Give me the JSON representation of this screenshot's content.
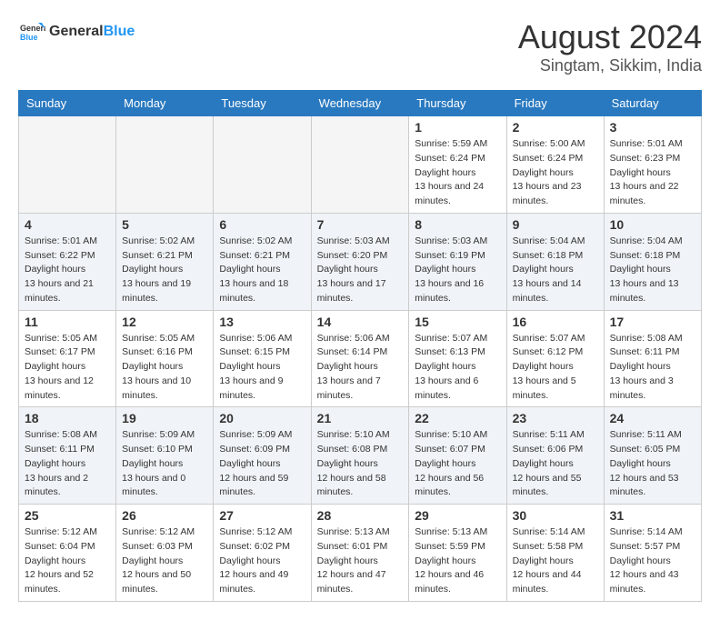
{
  "header": {
    "logo": {
      "general": "General",
      "blue": "Blue"
    },
    "title": "August 2024",
    "location": "Singtam, Sikkim, India"
  },
  "calendar": {
    "days_of_week": [
      "Sunday",
      "Monday",
      "Tuesday",
      "Wednesday",
      "Thursday",
      "Friday",
      "Saturday"
    ],
    "weeks": [
      [
        {
          "day": null,
          "sunrise": null,
          "sunset": null,
          "daylight": null
        },
        {
          "day": null,
          "sunrise": null,
          "sunset": null,
          "daylight": null
        },
        {
          "day": null,
          "sunrise": null,
          "sunset": null,
          "daylight": null
        },
        {
          "day": null,
          "sunrise": null,
          "sunset": null,
          "daylight": null
        },
        {
          "day": "1",
          "sunrise": "5:59 AM",
          "sunset": "6:24 PM",
          "daylight": "13 hours and 24 minutes."
        },
        {
          "day": "2",
          "sunrise": "5:00 AM",
          "sunset": "6:24 PM",
          "daylight": "13 hours and 23 minutes."
        },
        {
          "day": "3",
          "sunrise": "5:01 AM",
          "sunset": "6:23 PM",
          "daylight": "13 hours and 22 minutes."
        }
      ],
      [
        {
          "day": "4",
          "sunrise": "5:01 AM",
          "sunset": "6:22 PM",
          "daylight": "13 hours and 21 minutes."
        },
        {
          "day": "5",
          "sunrise": "5:02 AM",
          "sunset": "6:21 PM",
          "daylight": "13 hours and 19 minutes."
        },
        {
          "day": "6",
          "sunrise": "5:02 AM",
          "sunset": "6:21 PM",
          "daylight": "13 hours and 18 minutes."
        },
        {
          "day": "7",
          "sunrise": "5:03 AM",
          "sunset": "6:20 PM",
          "daylight": "13 hours and 17 minutes."
        },
        {
          "day": "8",
          "sunrise": "5:03 AM",
          "sunset": "6:19 PM",
          "daylight": "13 hours and 16 minutes."
        },
        {
          "day": "9",
          "sunrise": "5:04 AM",
          "sunset": "6:18 PM",
          "daylight": "13 hours and 14 minutes."
        },
        {
          "day": "10",
          "sunrise": "5:04 AM",
          "sunset": "6:18 PM",
          "daylight": "13 hours and 13 minutes."
        }
      ],
      [
        {
          "day": "11",
          "sunrise": "5:05 AM",
          "sunset": "6:17 PM",
          "daylight": "13 hours and 12 minutes."
        },
        {
          "day": "12",
          "sunrise": "5:05 AM",
          "sunset": "6:16 PM",
          "daylight": "13 hours and 10 minutes."
        },
        {
          "day": "13",
          "sunrise": "5:06 AM",
          "sunset": "6:15 PM",
          "daylight": "13 hours and 9 minutes."
        },
        {
          "day": "14",
          "sunrise": "5:06 AM",
          "sunset": "6:14 PM",
          "daylight": "13 hours and 7 minutes."
        },
        {
          "day": "15",
          "sunrise": "5:07 AM",
          "sunset": "6:13 PM",
          "daylight": "13 hours and 6 minutes."
        },
        {
          "day": "16",
          "sunrise": "5:07 AM",
          "sunset": "6:12 PM",
          "daylight": "13 hours and 5 minutes."
        },
        {
          "day": "17",
          "sunrise": "5:08 AM",
          "sunset": "6:11 PM",
          "daylight": "13 hours and 3 minutes."
        }
      ],
      [
        {
          "day": "18",
          "sunrise": "5:08 AM",
          "sunset": "6:11 PM",
          "daylight": "13 hours and 2 minutes."
        },
        {
          "day": "19",
          "sunrise": "5:09 AM",
          "sunset": "6:10 PM",
          "daylight": "13 hours and 0 minutes."
        },
        {
          "day": "20",
          "sunrise": "5:09 AM",
          "sunset": "6:09 PM",
          "daylight": "12 hours and 59 minutes."
        },
        {
          "day": "21",
          "sunrise": "5:10 AM",
          "sunset": "6:08 PM",
          "daylight": "12 hours and 58 minutes."
        },
        {
          "day": "22",
          "sunrise": "5:10 AM",
          "sunset": "6:07 PM",
          "daylight": "12 hours and 56 minutes."
        },
        {
          "day": "23",
          "sunrise": "5:11 AM",
          "sunset": "6:06 PM",
          "daylight": "12 hours and 55 minutes."
        },
        {
          "day": "24",
          "sunrise": "5:11 AM",
          "sunset": "6:05 PM",
          "daylight": "12 hours and 53 minutes."
        }
      ],
      [
        {
          "day": "25",
          "sunrise": "5:12 AM",
          "sunset": "6:04 PM",
          "daylight": "12 hours and 52 minutes."
        },
        {
          "day": "26",
          "sunrise": "5:12 AM",
          "sunset": "6:03 PM",
          "daylight": "12 hours and 50 minutes."
        },
        {
          "day": "27",
          "sunrise": "5:12 AM",
          "sunset": "6:02 PM",
          "daylight": "12 hours and 49 minutes."
        },
        {
          "day": "28",
          "sunrise": "5:13 AM",
          "sunset": "6:01 PM",
          "daylight": "12 hours and 47 minutes."
        },
        {
          "day": "29",
          "sunrise": "5:13 AM",
          "sunset": "5:59 PM",
          "daylight": "12 hours and 46 minutes."
        },
        {
          "day": "30",
          "sunrise": "5:14 AM",
          "sunset": "5:58 PM",
          "daylight": "12 hours and 44 minutes."
        },
        {
          "day": "31",
          "sunrise": "5:14 AM",
          "sunset": "5:57 PM",
          "daylight": "12 hours and 43 minutes."
        }
      ]
    ]
  }
}
